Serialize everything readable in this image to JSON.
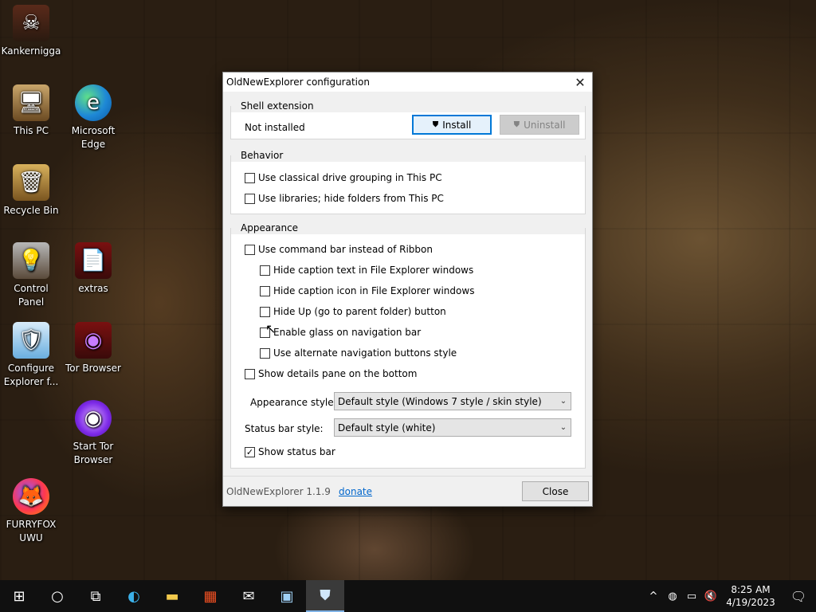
{
  "desktop": {
    "icons": [
      {
        "label": "Kankernigga",
        "icon": "skull-icon"
      },
      {
        "label": "This PC",
        "icon": "computer-icon"
      },
      {
        "label": "Microsoft Edge",
        "icon": "edge-icon"
      },
      {
        "label": "Recycle Bin",
        "icon": "recycle-bin-icon"
      },
      {
        "label": "Control Panel",
        "icon": "control-panel-icon"
      },
      {
        "label": "extras",
        "icon": "pdf-file-icon"
      },
      {
        "label": "Configure Explorer f...",
        "icon": "shield-folder-icon"
      },
      {
        "label": "Tor Browser",
        "icon": "tor-icon"
      },
      {
        "label": "Start Tor Browser",
        "icon": "tor-icon"
      },
      {
        "label": "FURRYFOX UWU",
        "icon": "firefox-icon"
      }
    ]
  },
  "dialog": {
    "title": "OldNewExplorer configuration",
    "shell_extension": {
      "title": "Shell extension",
      "status": "Not installed",
      "install_label": "Install",
      "uninstall_label": "Uninstall"
    },
    "behavior": {
      "title": "Behavior",
      "options": [
        {
          "label": "Use classical drive grouping in This PC",
          "checked": false
        },
        {
          "label": "Use libraries; hide folders from This PC",
          "checked": false
        }
      ]
    },
    "appearance": {
      "title": "Appearance",
      "options": [
        {
          "label": "Use command bar instead of Ribbon",
          "checked": false
        },
        {
          "label": "Hide caption text in File Explorer windows",
          "checked": false
        },
        {
          "label": "Hide caption icon in File Explorer windows",
          "checked": false
        },
        {
          "label": "Hide Up (go to parent folder) button",
          "checked": false
        },
        {
          "label": "Enable glass on navigation bar",
          "checked": false
        },
        {
          "label": "Use alternate navigation buttons style",
          "checked": false
        },
        {
          "label": "Show details pane on the bottom",
          "checked": false
        },
        {
          "label": "Show status bar",
          "checked": true
        }
      ],
      "appearance_style_label": "Appearance style:",
      "appearance_style_value": "Default style (Windows 7 style / skin style)",
      "status_bar_style_label": "Status bar style:",
      "status_bar_style_value": "Default style (white)"
    },
    "footer": {
      "version": "OldNewExplorer 1.1.9",
      "donate": "donate",
      "close_label": "Close"
    }
  },
  "taskbar": {
    "items": [
      "start-icon",
      "search-icon",
      "task-view-icon",
      "edge-icon",
      "file-explorer-icon",
      "store-icon",
      "mail-icon",
      "photos-icon",
      "shield-folder-icon"
    ],
    "tray": {
      "time": "8:25 AM",
      "date": "4/19/2023"
    }
  }
}
